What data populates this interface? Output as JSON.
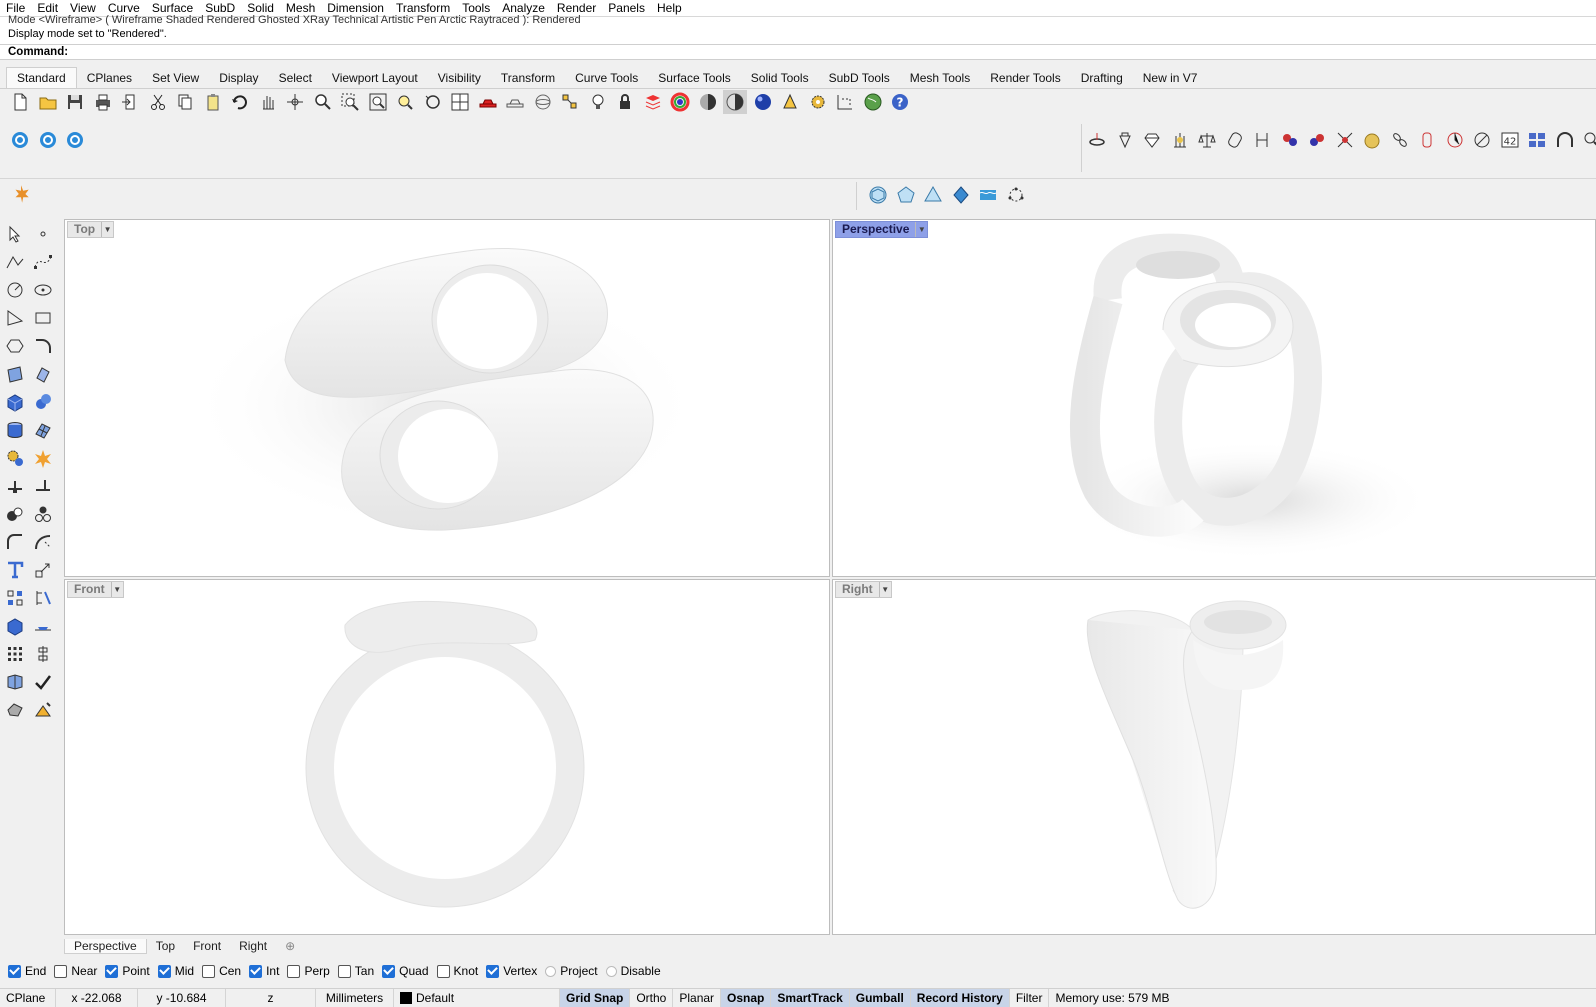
{
  "menu": [
    "File",
    "Edit",
    "View",
    "Curve",
    "Surface",
    "SubD",
    "Solid",
    "Mesh",
    "Dimension",
    "Transform",
    "Tools",
    "Analyze",
    "Render",
    "Panels",
    "Help"
  ],
  "history": {
    "line1": "Mode <Wireframe> ( Wireframe  Shaded  Rendered  Ghosted  XRay  Technical  Artistic  Pen  Arctic  Raytraced ): Rendered",
    "line2": "Display mode set to \"Rendered\"."
  },
  "command_label": "Command:",
  "toolbar_tabs": [
    "Standard",
    "CPlanes",
    "Set View",
    "Display",
    "Select",
    "Viewport Layout",
    "Visibility",
    "Transform",
    "Curve Tools",
    "Surface Tools",
    "Solid Tools",
    "SubD Tools",
    "Mesh Tools",
    "Render Tools",
    "Drafting",
    "New in V7"
  ],
  "active_tab": "Standard",
  "viewports": {
    "top": {
      "label": "Top"
    },
    "perspective": {
      "label": "Perspective"
    },
    "front": {
      "label": "Front"
    },
    "right": {
      "label": "Right"
    }
  },
  "viewport_tabs": [
    "Perspective",
    "Top",
    "Front",
    "Right"
  ],
  "osnap": [
    {
      "label": "End",
      "checked": true
    },
    {
      "label": "Near",
      "checked": false
    },
    {
      "label": "Point",
      "checked": true
    },
    {
      "label": "Mid",
      "checked": true
    },
    {
      "label": "Cen",
      "checked": false
    },
    {
      "label": "Int",
      "checked": true
    },
    {
      "label": "Perp",
      "checked": false
    },
    {
      "label": "Tan",
      "checked": false
    },
    {
      "label": "Quad",
      "checked": true
    },
    {
      "label": "Knot",
      "checked": false
    },
    {
      "label": "Vertex",
      "checked": true
    },
    {
      "label": "Project",
      "disabled": true
    },
    {
      "label": "Disable",
      "disabled": true
    }
  ],
  "status": {
    "cplane": "CPlane",
    "x": "x -22.068",
    "y": "y -10.684",
    "z": "z",
    "units": "Millimeters",
    "layer": "Default",
    "grid_snap": "Grid Snap",
    "ortho": "Ortho",
    "planar": "Planar",
    "osnap": "Osnap",
    "smarttrack": "SmartTrack",
    "gumball": "Gumball",
    "record_history": "Record History",
    "filter": "Filter",
    "memory": "Memory use: 579 MB"
  },
  "colors": {
    "active_viewport": "#8ea0e8",
    "checkbox_on": "#1f6fd6",
    "status_on": "#c8d4e8"
  }
}
